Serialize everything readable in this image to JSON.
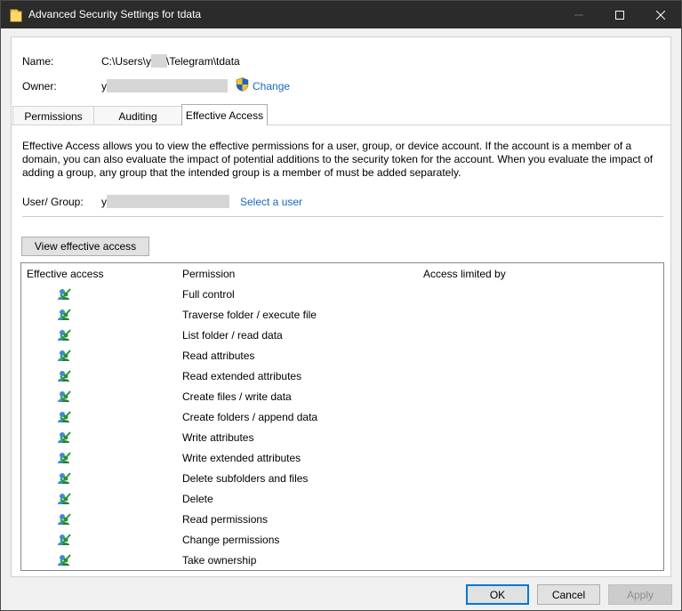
{
  "window": {
    "title": "Advanced Security Settings for tdata"
  },
  "info": {
    "name_label": "Name:",
    "name_prefix": "C:\\Users\\y",
    "name_suffix": "\\Telegram\\tdata",
    "owner_label": "Owner:",
    "owner_prefix": "y",
    "change_link": "Change"
  },
  "tabs": [
    {
      "label": "Permissions"
    },
    {
      "label": "Auditing"
    },
    {
      "label": "Effective Access"
    }
  ],
  "effective": {
    "description": "Effective Access allows you to view the effective permissions for a user, group, or device account. If the account is a member of a domain, you can also evaluate the impact of potential additions to the security token for the account. When you evaluate the impact of adding a group, any group that the intended group is a member of must be added separately.",
    "user_group_label": "User/ Group:",
    "user_prefix": "y",
    "select_user_link": "Select a user",
    "view_button": "View effective access"
  },
  "table": {
    "columns": [
      "Effective access",
      "Permission",
      "Access limited by"
    ],
    "rows": [
      {
        "permission": "Full control",
        "icon": "allowed-user-icon"
      },
      {
        "permission": "Traverse folder / execute file",
        "icon": "allowed-user-icon"
      },
      {
        "permission": "List folder / read data",
        "icon": "allowed-user-icon"
      },
      {
        "permission": "Read attributes",
        "icon": "allowed-user-icon"
      },
      {
        "permission": "Read extended attributes",
        "icon": "allowed-user-icon"
      },
      {
        "permission": "Create files / write data",
        "icon": "allowed-user-icon"
      },
      {
        "permission": "Create folders / append data",
        "icon": "allowed-user-icon"
      },
      {
        "permission": "Write attributes",
        "icon": "allowed-user-icon"
      },
      {
        "permission": "Write extended attributes",
        "icon": "allowed-user-icon"
      },
      {
        "permission": "Delete subfolders and files",
        "icon": "allowed-user-icon"
      },
      {
        "permission": "Delete",
        "icon": "allowed-user-icon"
      },
      {
        "permission": "Read permissions",
        "icon": "allowed-user-icon"
      },
      {
        "permission": "Change permissions",
        "icon": "allowed-user-icon"
      },
      {
        "permission": "Take ownership",
        "icon": "allowed-user-icon"
      }
    ]
  },
  "footer": {
    "ok": "OK",
    "cancel": "Cancel",
    "apply": "Apply"
  },
  "colors": {
    "link": "#1a66c2",
    "titlebar": "#2b2b2b",
    "default_button_border": "#0078d7"
  }
}
